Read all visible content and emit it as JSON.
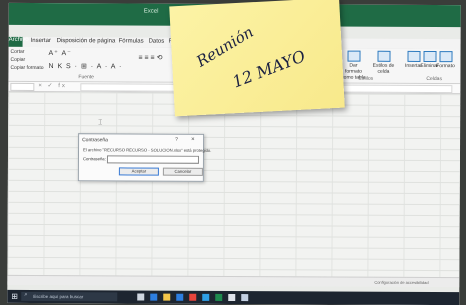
{
  "window": {
    "title": "Excel"
  },
  "ribbon": {
    "tabs": [
      "Archivo",
      "Insertar",
      "Disposición de página",
      "Fórmulas",
      "Datos",
      "R"
    ],
    "clipboard": [
      "Cortar",
      "Copiar",
      "Copiar formato"
    ],
    "font_row1": "A⁺ A⁻",
    "font_row2": "N K S ·  ⊞ · A · A ·",
    "align": "≡ ≡ ≡  ⟲",
    "group_labels": {
      "fuente": "Fuente",
      "estilos": "Estilos",
      "celdas": "Celdas"
    },
    "buttons": [
      {
        "label": "Dar formato como tabla"
      },
      {
        "label": "Estilos de celda"
      },
      {
        "label": "Insertar"
      },
      {
        "label": "Eliminar"
      },
      {
        "label": "Formato"
      }
    ]
  },
  "formula_bar": {
    "icons": "× ✓ fx"
  },
  "dialog": {
    "title": "Contraseña",
    "help": "?",
    "close": "×",
    "message": "El archivo \"RECURSO RECURSO - SOLUCION.xlsx\" está protegido.",
    "label": "Contraseña:",
    "password_value": "",
    "accept": "Aceptar",
    "cancel": "Cancelar"
  },
  "status_bar": {
    "text": "Configuración de accesibilidad"
  },
  "taskbar": {
    "start": "⊞",
    "search_icon": "⌕",
    "search_placeholder": "Escribe aquí para buscar",
    "app_icon_colors": [
      "#cfd6df",
      "#2d7ee0",
      "#f3c64a",
      "#2d7ee0",
      "#e8453c",
      "#2ea0e6",
      "#1e8a4e",
      "#dfe3ea",
      "#c3d0e2"
    ]
  },
  "sticky_note": {
    "line1": "Reunión",
    "line2": "12 MAYO"
  }
}
